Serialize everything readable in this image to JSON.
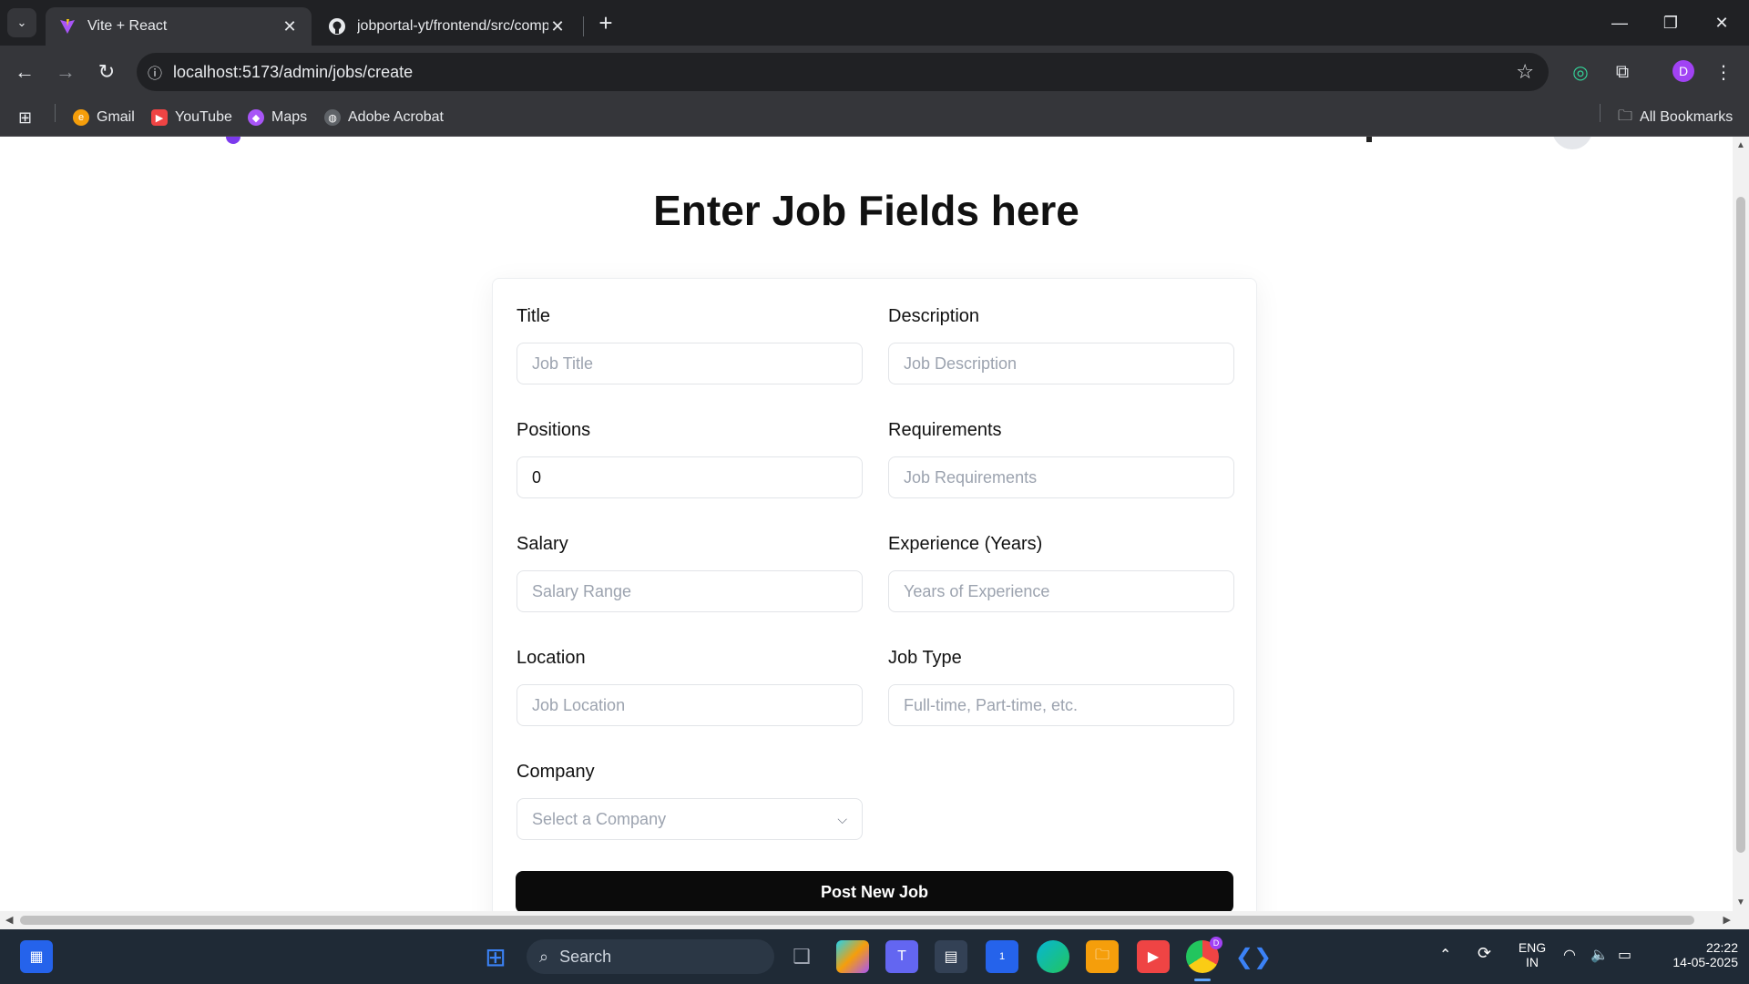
{
  "browser": {
    "tabs": [
      {
        "title": "Vite + React",
        "active": true
      },
      {
        "title": "jobportal-yt/frontend/src/comp",
        "active": false
      }
    ],
    "url": "localhost:5173/admin/jobs/create",
    "profile_initial": "D",
    "bookmarks": [
      "Gmail",
      "YouTube",
      "Maps",
      "Adobe Acrobat"
    ],
    "all_bookmarks": "All Bookmarks"
  },
  "page": {
    "title": "Enter Job Fields here",
    "fields": [
      {
        "label": "Title",
        "placeholder": "Job Title",
        "value": ""
      },
      {
        "label": "Description",
        "placeholder": "Job Description",
        "value": ""
      },
      {
        "label": "Positions",
        "placeholder": "",
        "value": "0"
      },
      {
        "label": "Requirements",
        "placeholder": "Job Requirements",
        "value": ""
      },
      {
        "label": "Salary",
        "placeholder": "Salary Range",
        "value": ""
      },
      {
        "label": "Experience (Years)",
        "placeholder": "Years of Experience",
        "value": ""
      },
      {
        "label": "Location",
        "placeholder": "Job Location",
        "value": ""
      },
      {
        "label": "Job Type",
        "placeholder": "Full-time, Part-time, etc.",
        "value": ""
      }
    ],
    "company": {
      "label": "Company",
      "placeholder": "Select a Company"
    },
    "submit_label": "Post New Job"
  },
  "taskbar": {
    "search_label": "Search",
    "language": "ENG",
    "region": "IN",
    "time": "22:22",
    "date": "14-05-2025",
    "chrome_badge": "D",
    "outlook_badge": "1"
  },
  "colors": {
    "accent_purple": "#7c3aed",
    "button_bg": "#0b0b0b",
    "chrome_dark": "#202124",
    "taskbar_bg": "#1f2a36"
  }
}
